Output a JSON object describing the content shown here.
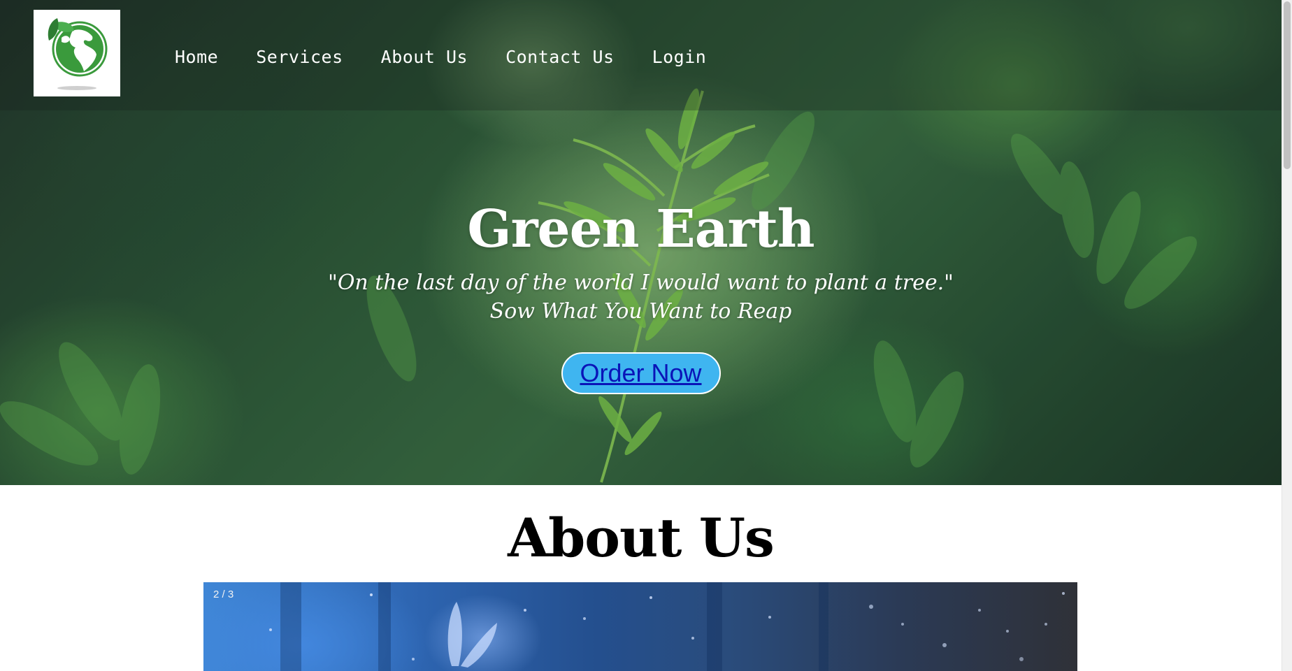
{
  "nav": {
    "logo_alt": "Green Earth globe logo",
    "links": [
      "Home",
      "Services",
      "About Us",
      "Contact Us",
      "Login"
    ]
  },
  "hero": {
    "title": "Green Earth",
    "quote": "\"On the last day of the world I would want to plant a tree.\"",
    "tagline": "Sow What You Want to Reap",
    "button": "Order Now"
  },
  "about": {
    "title": "About Us",
    "slide_counter": "2 / 3"
  },
  "icons": {
    "logo": "globe-leaf-icon"
  },
  "colors": {
    "accent_button": "#3fb5f0",
    "button_text": "#0a14b8",
    "brand_green": "#3a9a3c"
  }
}
